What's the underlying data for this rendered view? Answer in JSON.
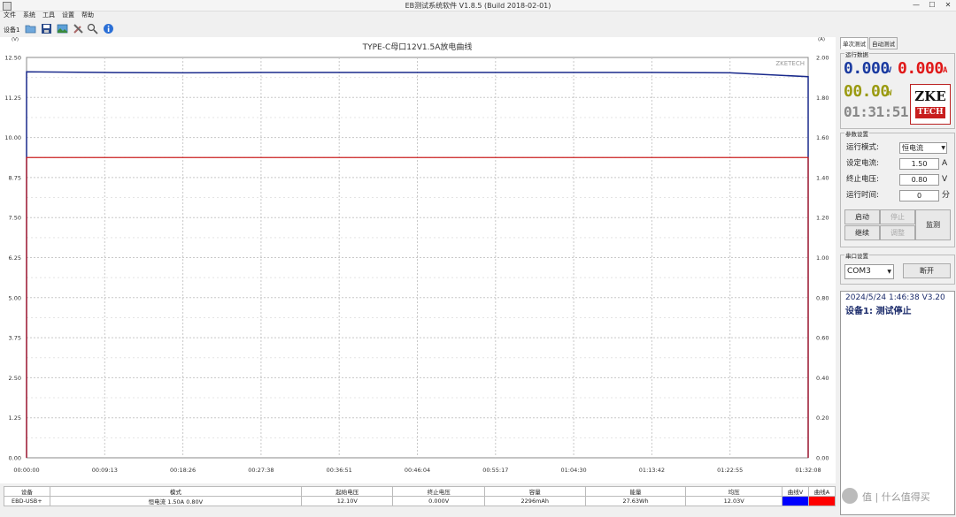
{
  "window": {
    "title": "EB测试系统软件 V1.8.5 (Build 2018-02-01)",
    "min_glyph": "—",
    "max_glyph": "☐",
    "close_glyph": "✕"
  },
  "menu": [
    "文件",
    "系统",
    "工具",
    "设置",
    "帮助"
  ],
  "toolbar": {
    "device_label": "设备1",
    "icons": [
      "folder-open-icon",
      "save-icon",
      "image-icon",
      "tools-icon",
      "search-icon",
      "info-icon"
    ]
  },
  "chart": {
    "title": "TYPE-C母口12V1.5A放电曲线",
    "left_unit": "(V)",
    "right_unit": "(A)",
    "brand": "ZKETECH",
    "left_ticks": [
      "12.50",
      "11.25",
      "10.00",
      "8.75",
      "7.50",
      "6.25",
      "5.00",
      "3.75",
      "2.50",
      "1.25",
      "0.00"
    ],
    "right_ticks": [
      "2.00",
      "1.80",
      "1.60",
      "1.40",
      "1.20",
      "1.00",
      "0.80",
      "0.60",
      "0.40",
      "0.20",
      "0.00"
    ],
    "x_ticks": [
      "00:00:00",
      "00:09:13",
      "00:18:26",
      "00:27:38",
      "00:36:51",
      "00:46:04",
      "00:55:17",
      "01:04:30",
      "01:13:42",
      "01:22:55",
      "01:32:08"
    ],
    "voltage_color": "#1a2a8c",
    "current_color": "#cc2020"
  },
  "chart_data": {
    "type": "line",
    "title": "TYPE-C母口12V1.5A放电曲线",
    "x": [
      "00:00:00",
      "00:09:13",
      "00:18:26",
      "00:27:38",
      "00:36:51",
      "00:46:04",
      "00:55:17",
      "01:04:30",
      "01:13:42",
      "01:22:55",
      "01:32:08"
    ],
    "series": [
      {
        "name": "曲线V",
        "axis": "left",
        "values": [
          12.05,
          12.03,
          12.02,
          12.03,
          12.03,
          12.03,
          12.03,
          12.03,
          12.03,
          12.02,
          11.9
        ]
      },
      {
        "name": "曲线A",
        "axis": "right",
        "values": [
          1.5,
          1.5,
          1.5,
          1.5,
          1.5,
          1.5,
          1.5,
          1.5,
          1.5,
          1.5,
          1.5
        ]
      }
    ],
    "ylim_left": [
      0,
      12.5
    ],
    "ylim_right": [
      0,
      2.0
    ],
    "grid": true
  },
  "table": {
    "headers": [
      "设备",
      "模式",
      "起始电压",
      "终止电压",
      "容量",
      "能量",
      "均压",
      "曲线V",
      "曲线A"
    ],
    "row": [
      "EBD-USB+",
      "恒电流 1.50A 0.80V",
      "12.10V",
      "0.000V",
      "2296mAh",
      "27.63Wh",
      "12.03V",
      "",
      ""
    ],
    "curveV_color": "#0000ff",
    "curveA_color": "#ff0000"
  },
  "panel": {
    "tab_single": "单次测试",
    "tab_auto": "自动测试",
    "run_data_title": "运行数据",
    "voltage": "0.000",
    "voltage_unit": "V",
    "current": "0.000",
    "current_unit": "A",
    "power": "00.00",
    "power_unit": "W",
    "time": "01:31:51",
    "logo_top": "ZKE",
    "logo_bottom": "TECH",
    "params_title": "参数设置",
    "mode_label": "运行模式:",
    "mode_value": "恒电流",
    "set_current_label": "设定电流:",
    "set_current_value": "1.50",
    "set_current_unit": "A",
    "cutoff_label": "终止电压:",
    "cutoff_value": "0.80",
    "cutoff_unit": "V",
    "runtime_label": "运行时间:",
    "runtime_value": "0",
    "runtime_unit": "分",
    "btn_start": "启动",
    "btn_stop": "停止",
    "btn_monitor": "监测",
    "btn_continue": "继续",
    "btn_adjust": "调整",
    "serial_title": "串口设置",
    "com_value": "COM3",
    "btn_disconnect": "断开",
    "status_line1": "2024/5/24 1:46:38  V3.20",
    "status_line2": "设备1: 测试停止",
    "watermark": "值 | 什么值得买"
  }
}
